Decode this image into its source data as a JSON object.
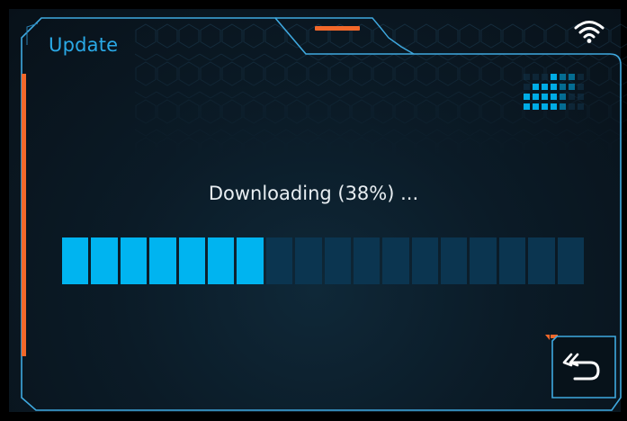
{
  "header": {
    "title": "Update"
  },
  "status": {
    "wifi_icon": "wifi-icon"
  },
  "update": {
    "message": "Downloading (38%) ...",
    "progress_percent": 38,
    "filled_segments": 7,
    "total_segments": 18
  },
  "controls": {
    "back_icon": "back-arrow-icon"
  },
  "colors": {
    "accent_blue": "#00b4f0",
    "title_blue": "#2aa9e6",
    "frame_blue": "#3fa9e0",
    "accent_orange": "#f2682a",
    "segment_off": "#0b3550"
  }
}
